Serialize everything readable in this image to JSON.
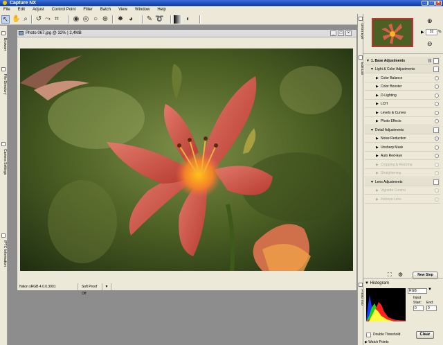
{
  "app": {
    "title": "Capture NX"
  },
  "menu": [
    "File",
    "Edit",
    "Adjust",
    "Control Point",
    "Filter",
    "Batch",
    "View",
    "Window",
    "Help"
  ],
  "left_tabs": [
    "Browser",
    "File Directory",
    "Camera Settings",
    "IPTC Information"
  ],
  "right_strip_tabs": [
    "Bird's Eye",
    "Edit List",
    "Photo Info"
  ],
  "document": {
    "title": "Photo 067.jpg @ 32% | 2,4MB",
    "status_profile": "Nikon sRGB 4.0.0.3001",
    "status_softproof": "Soft Proof Off"
  },
  "birds_eye": {
    "zoom": "32",
    "zoom_unit": "%"
  },
  "edit_list": {
    "base": "1. Base Adjustments",
    "rows": [
      {
        "label": "Light & Color Adjustments",
        "type": "group"
      },
      {
        "label": "Color Balance",
        "type": "item"
      },
      {
        "label": "Color Booster",
        "type": "item"
      },
      {
        "label": "D-Lighting",
        "type": "item"
      },
      {
        "label": "LCH",
        "type": "item"
      },
      {
        "label": "Levels & Curves",
        "type": "item"
      },
      {
        "label": "Photo Effects",
        "type": "item"
      },
      {
        "label": "Detail Adjustments",
        "type": "group"
      },
      {
        "label": "Noise Reduction",
        "type": "item",
        "selected": true
      },
      {
        "label": "Unsharp Mask",
        "type": "item"
      },
      {
        "label": "Auto Red-Eye",
        "type": "item"
      },
      {
        "label": "Cropping & Resizing",
        "type": "disabled"
      },
      {
        "label": "Straightening",
        "type": "disabled"
      },
      {
        "label": "Lens Adjustments",
        "type": "group"
      },
      {
        "label": "Vignette Control",
        "type": "disabled"
      },
      {
        "label": "Fisheye Lens",
        "type": "disabled"
      }
    ],
    "new_step_label": "New Step"
  },
  "histogram": {
    "title": "Histogram",
    "channel": "RGB",
    "input_label": "Input",
    "start_label": "Start:",
    "end_label": "End:",
    "start_value": "0",
    "end_value": "0",
    "double_threshold_label": "Double Threshold",
    "clear_label": "Clear",
    "watch_points_label": "Watch Points"
  },
  "colors": {
    "titlebar": "#0a3aa4",
    "chrome": "#ece9d8",
    "workspace": "#8d8d8d",
    "thumb_border": "#c03030"
  }
}
